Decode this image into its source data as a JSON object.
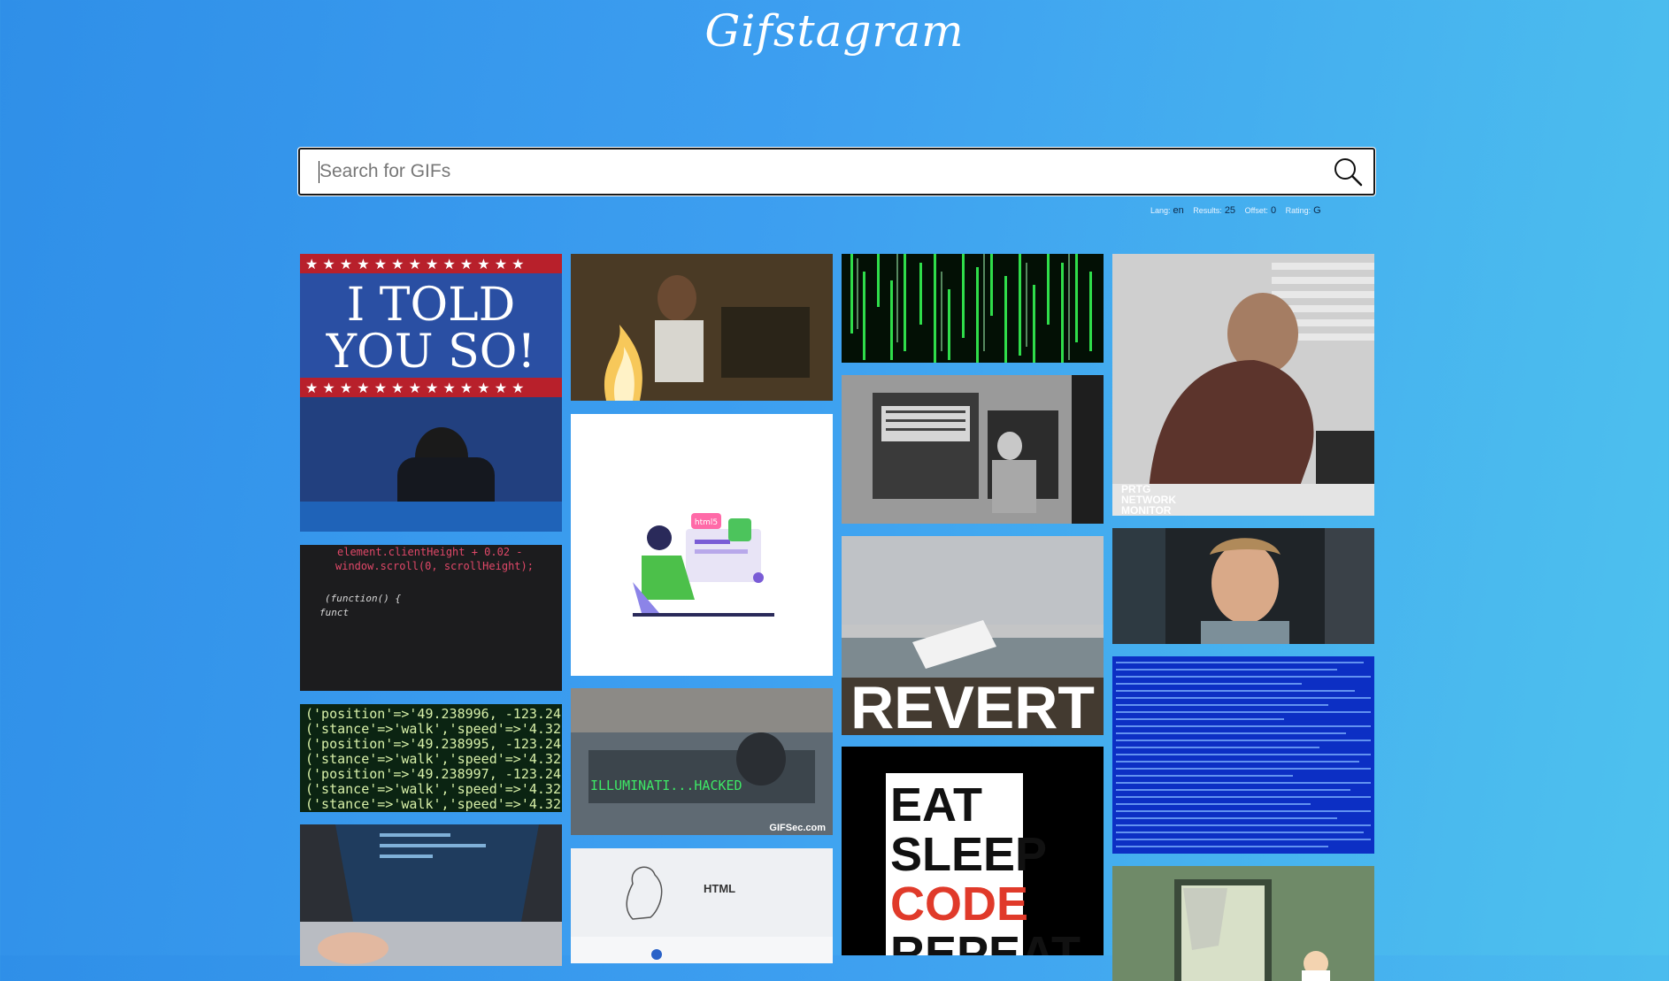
{
  "app": {
    "title": "Gifstagram"
  },
  "search": {
    "placeholder": "Search for GIFs",
    "value": ""
  },
  "settings": {
    "lang_label": "Lang:",
    "lang_value": "en",
    "results_label": "Results:",
    "results_value": "25",
    "offset_label": "Offset:",
    "offset_value": "0",
    "rating_label": "Rating:",
    "rating_value": "G"
  },
  "gifs": {
    "told_you_so": {
      "line1": "I TOLD",
      "line2": "YOU SO!"
    },
    "code_scroll": {
      "line1": "element.clientHeight + 0.02 -",
      "line2": "window.scroll(0, scrollHeight);",
      "line3": "(function() {",
      "line4": "funct"
    },
    "data_log": {
      "line1": "('position'=>'49.238996, -123.24",
      "line2": "('stance'=>'walk','speed'=>'4.32",
      "line3": "('position'=>'49.238995, -123.24",
      "line4": "('stance'=>'walk','speed'=>'4.32",
      "line5": "('position'=>'49.238997, -123.24",
      "line6": "('stance'=>'walk','speed'=>'4.32",
      "line7": "('stance'=>'walk','speed'=>'4.32"
    },
    "developer_illustration": {
      "badge": "html5"
    },
    "hacked": {
      "caption": "ILLUMINATI...HACKED",
      "watermark": "GIFSec.com"
    },
    "html_card": {
      "label": "HTML"
    },
    "revert": {
      "caption": "REVERT"
    },
    "eat_sleep": {
      "w1": "EAT",
      "w2": "SLEEP",
      "w3": "CODE",
      "w4": "REPEAT"
    },
    "prtg": {
      "w1": "PRTG",
      "w2": "NETWORK",
      "w3": "MONITOR"
    }
  }
}
